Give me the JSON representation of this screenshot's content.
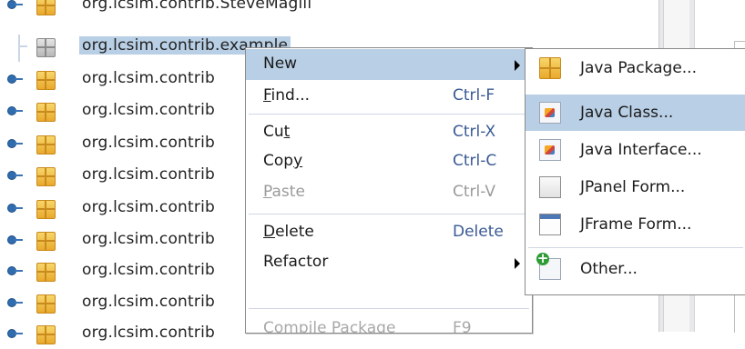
{
  "tree": {
    "rows": [
      {
        "label": "org.lcsim.contrib.SteveMagill",
        "selected": false,
        "empty": false
      },
      {
        "label": "org.lcsim.contrib.example",
        "selected": true,
        "empty": true
      },
      {
        "label": "org.lcsim.contrib",
        "selected": false,
        "empty": false
      },
      {
        "label": "org.lcsim.contrib",
        "selected": false,
        "empty": false
      },
      {
        "label": "org.lcsim.contrib",
        "selected": false,
        "empty": false
      },
      {
        "label": "org.lcsim.contrib",
        "selected": false,
        "empty": false
      },
      {
        "label": "org.lcsim.contrib",
        "selected": false,
        "empty": false
      },
      {
        "label": "org.lcsim.contrib",
        "selected": false,
        "empty": false
      },
      {
        "label": "org.lcsim.contrib",
        "selected": false,
        "empty": false
      },
      {
        "label": "org.lcsim.contrib",
        "selected": false,
        "empty": false
      },
      {
        "label": "org.lcsim.contrib",
        "selected": false,
        "empty": false
      }
    ]
  },
  "context_menu": {
    "new": {
      "pre": "",
      "mnemonic": "",
      "post": "New"
    },
    "find": {
      "pre": "",
      "mnemonic": "F",
      "post": "ind...",
      "shortcut": "Ctrl-F"
    },
    "cut": {
      "pre": "Cu",
      "mnemonic": "t",
      "post": "",
      "shortcut": "Ctrl-X"
    },
    "copy": {
      "pre": "Cop",
      "mnemonic": "y",
      "post": "",
      "shortcut": "Ctrl-C"
    },
    "paste": {
      "pre": "",
      "mnemonic": "P",
      "post": "aste",
      "shortcut": "Ctrl-V"
    },
    "delete": {
      "pre": "",
      "mnemonic": "D",
      "post": "elete",
      "shortcut": "Delete"
    },
    "refactor": {
      "label": "Refactor"
    },
    "compile_package": {
      "label": "Compile Package",
      "shortcut": "F9"
    }
  },
  "submenu": {
    "items": [
      {
        "label": "Java Package...",
        "icon": "java-package-icon"
      },
      {
        "label": "Java Class...",
        "icon": "java-class-icon"
      },
      {
        "label": "Java Interface...",
        "icon": "java-interface-icon"
      },
      {
        "label": "JPanel Form...",
        "icon": "jpanel-form-icon"
      },
      {
        "label": "JFrame Form...",
        "icon": "jframe-form-icon"
      },
      {
        "label": "Other...",
        "icon": "other-template-icon"
      }
    ]
  },
  "colors": {
    "selection": "#b8cfe5",
    "shortcut_text": "#3a5a95",
    "disabled_text": "#9a9a9a"
  }
}
